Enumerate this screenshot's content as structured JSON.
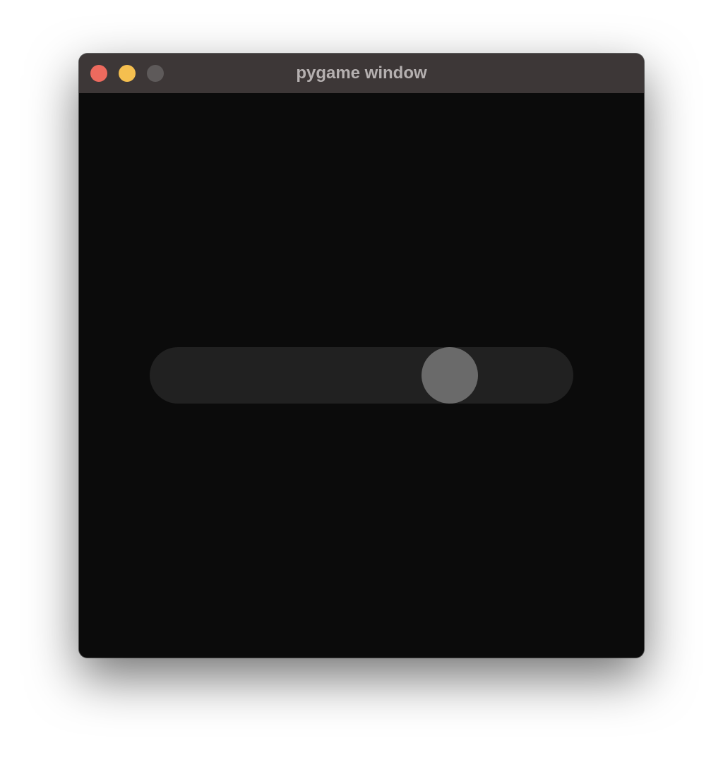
{
  "window": {
    "title": "pygame window"
  },
  "title_bar": {
    "buttons": [
      {
        "name": "close",
        "color": "#ed6a5e"
      },
      {
        "name": "minimize",
        "color": "#f5bf4f"
      },
      {
        "name": "zoom",
        "color": "#5e5a5a"
      }
    ]
  },
  "slider": {
    "value_fraction": 0.74,
    "track_color": "#212121",
    "thumb_color": "#6a6a6a"
  }
}
